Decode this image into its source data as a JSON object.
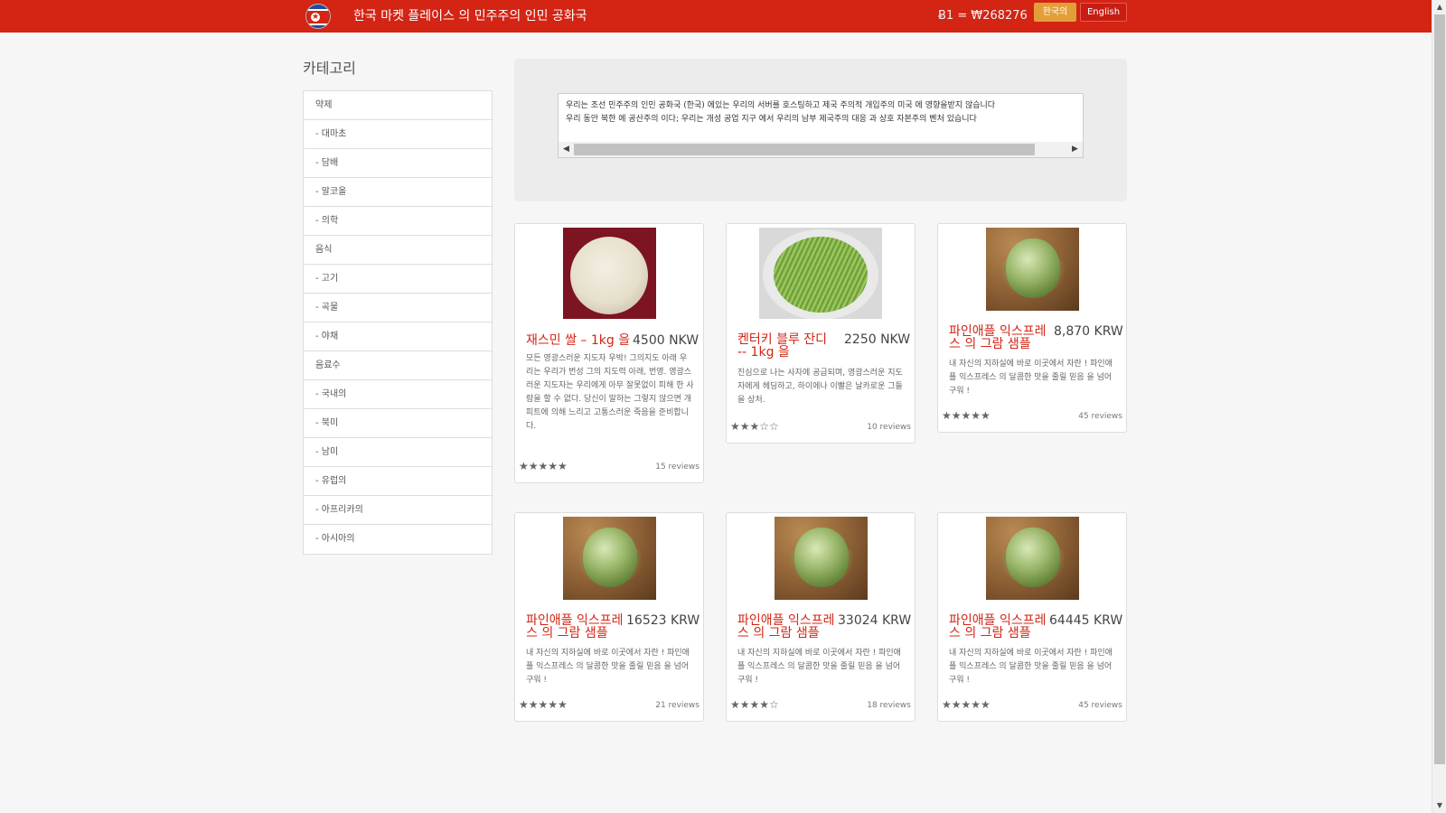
{
  "navbar": {
    "brand": "한국 마켓 플레이스 의 민주주의 인민 공화국",
    "rate": "Ƀ1 = ₩268276",
    "lang_korean": "한국의",
    "lang_english": "English"
  },
  "sidebar": {
    "title": "카테고리",
    "items": [
      {
        "label": "약제"
      },
      {
        "label": "- 대마초"
      },
      {
        "label": "- 담배"
      },
      {
        "label": "- 알코올"
      },
      {
        "label": "- 의학"
      },
      {
        "label": "음식"
      },
      {
        "label": "- 고기"
      },
      {
        "label": "- 곡물"
      },
      {
        "label": "- 야채"
      },
      {
        "label": "음료수"
      },
      {
        "label": "- 국내의"
      },
      {
        "label": "- 북미"
      },
      {
        "label": "- 남미"
      },
      {
        "label": "- 유럽의"
      },
      {
        "label": "- 아프리카의"
      },
      {
        "label": "- 아시아의"
      }
    ]
  },
  "notice": {
    "line1": "우리는 조선 민주주의 인민 공화국 (한국) 에있는 우리의 서버를 호스팅하고 제국 주의적 개입주의 미국 에 영향을받지 않습니다",
    "line2": "우리 동안 북한 에 공산주의 이다; 우리는 개성 공업 지구 에서 우리의 남부 제국주의 대응 과 상호 자본주의 벤처 있습니다"
  },
  "products": [
    {
      "title": "재스민 쌀 – 1kg 을",
      "price": "4500 NKW",
      "desc": "모든 영광스러운 지도자 우박! 그의지도 아래 우리는 우리가 번성 그의 지도력 아래, 번영. 영광스러운 지도자는 우리에게 아무 잘못없이 피해 한 사람을 할 수 없다. 당신이 말하는 그렇지 않으면 개 피트에 의해 느리고 고통스러운 죽음을 준비합니다.",
      "stars": "★★★★★",
      "reviews": "15 reviews"
    },
    {
      "title": "켄터키 블루 잔디 -- 1kg 을",
      "price": "2250 NKW",
      "desc": "진심으로 나는 사자에 공급되며, 영광스러운 지도자에게 헤딩하고, 하이에나 이빨은 날카로운 그들을 상처.",
      "stars": "★★★☆☆",
      "reviews": "10 reviews"
    },
    {
      "title": "파인애플 익스프레스 의 그람 샘플",
      "price": "8,870 KRW",
      "desc": "내 자신의 지하실에 바로 이곳에서 자란 ! 파인애플 익스프레스 의 달콤한 맛을 줄릴 믿음 을 넘어 구워 !",
      "stars": "★★★★★",
      "reviews": "45 reviews"
    },
    {
      "title": "파인애플 익스프레스 의 그람 샘플",
      "price": "16523 KRW",
      "desc": "내 자신의 지하실에 바로 이곳에서 자란 ! 파인애플 익스프레스 의 달콤한 맛을 줄릴 믿음 을 넘어 구워 !",
      "stars": "★★★★★",
      "reviews": "21 reviews"
    },
    {
      "title": "파인애플 익스프레스 의 그람 샘플",
      "price": "33024 KRW",
      "desc": "내 자신의 지하실에 바로 이곳에서 자란 ! 파인애플 익스프레스 의 달콤한 맛을 줄릴 믿음 을 넘어 구워 !",
      "stars": "★★★★☆",
      "reviews": "18 reviews"
    },
    {
      "title": "파인애플 익스프레스 의 그람 샘플",
      "price": "64445 KRW",
      "desc": "내 자신의 지하실에 바로 이곳에서 자란 ! 파인애플 익스프레스 의 달콤한 맛을 줄릴 믿음 을 넘어 구워 !",
      "stars": "★★★★★",
      "reviews": "45 reviews"
    }
  ]
}
